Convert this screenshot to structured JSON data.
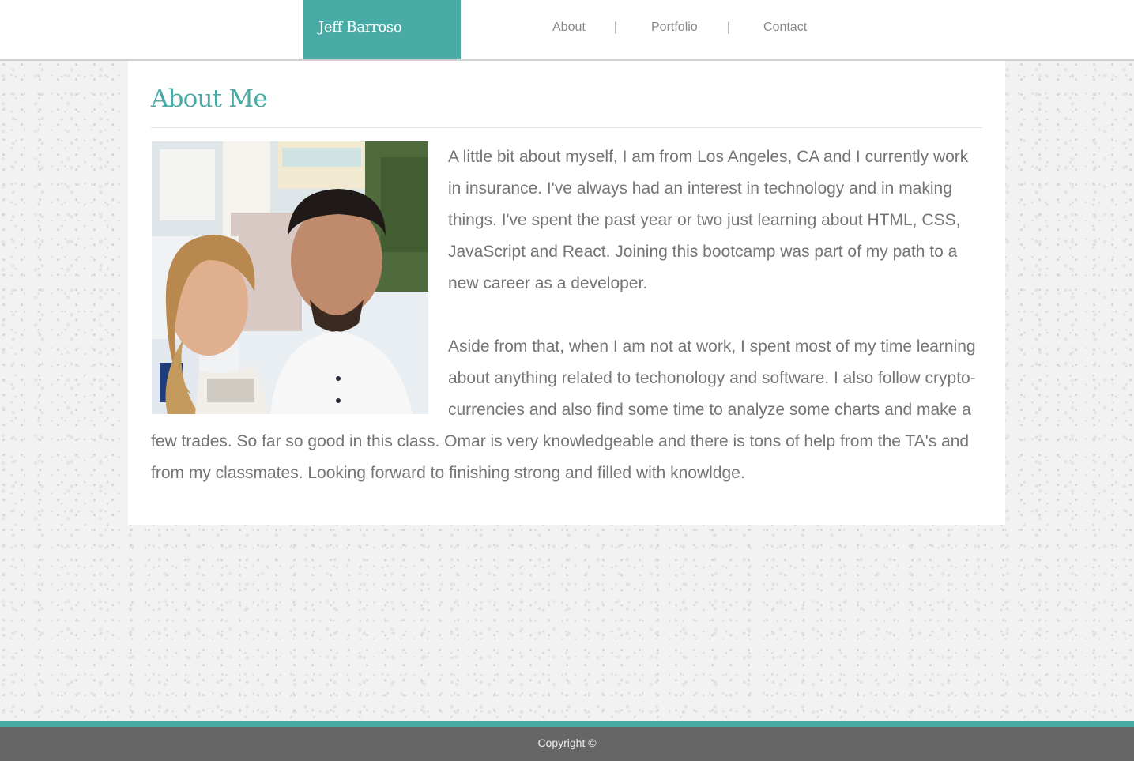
{
  "header": {
    "brand": "Jeff Barroso",
    "nav": [
      {
        "label": "About"
      },
      {
        "label": "Portfolio"
      },
      {
        "label": "Contact"
      }
    ],
    "separator": "|"
  },
  "main": {
    "title": "About Me",
    "paragraphs": [
      "A little bit about myself, I am from Los Angeles, CA and I currently work in insurance. I've always had an interest in technology and in making things. I've spent the past year or two just learning about HTML, CSS, JavaScript and React. Joining this bootcamp was part of my path to a new career as a developer.",
      "Aside from that, when I am not at work, I spent most of my time learning about anything related to techonology and software. I also follow crypto-currencies and also find some time to analyze some charts and make a few trades. So far so good in this class. Omar is very knowledgeable and there is tons of help from the TA's and from my classmates. Looking forward to finishing strong and filled with knowldge."
    ]
  },
  "footer": {
    "copyright": "Copyright ©"
  },
  "colors": {
    "accent": "#4aaaa5",
    "footer_bg": "#666666",
    "text": "#757575"
  }
}
